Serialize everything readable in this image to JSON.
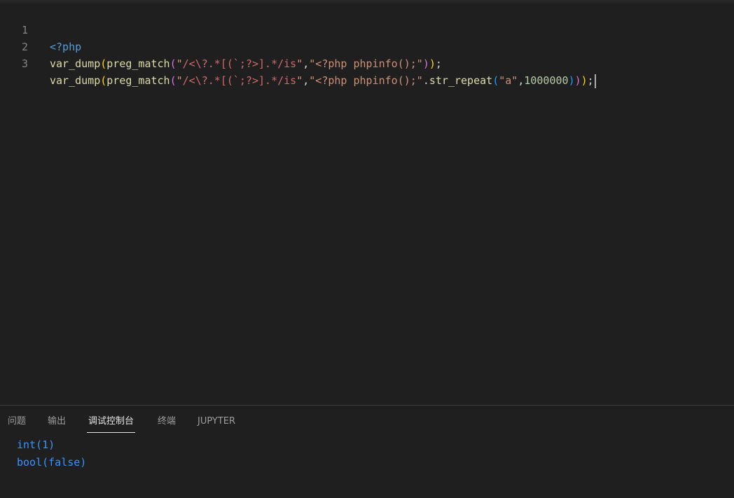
{
  "editor": {
    "lines": [
      {
        "number": "1",
        "text": "<?php"
      },
      {
        "number": "2",
        "text": "var_dump(preg_match(\"/<\\?.*[(`;?>].*/is\",\"<?php phpinfo();\"));"
      },
      {
        "number": "3",
        "text": "var_dump(preg_match(\"/<\\?.*[(`;?>].*/is\",\"<?php phpinfo();\".str_repeat(\"a\",1000000)));"
      }
    ]
  },
  "panel": {
    "tabs": [
      "问题",
      "输出",
      "调试控制台",
      "终端",
      "JUPYTER"
    ],
    "active_tab": "调试控制台",
    "console_output": [
      "int(1)",
      "bool(false)"
    ]
  },
  "colors": {
    "background": "#1f1f1f",
    "keyword": "#569cd6",
    "function": "#dcdcaa",
    "string": "#ce9178",
    "regex": "#d16969",
    "number": "#b5cea8",
    "console_text": "#3794ff"
  }
}
